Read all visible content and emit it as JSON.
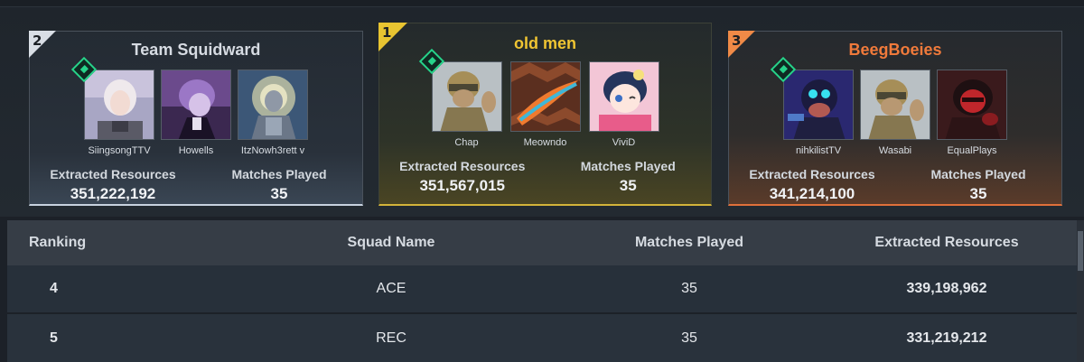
{
  "podium": [
    {
      "rank": "2",
      "team": "Team Squidward",
      "members": [
        {
          "name": "SiingsongTTV",
          "leader": true
        },
        {
          "name": "Howells",
          "leader": false
        },
        {
          "name": "ItzNowh3rett v",
          "leader": false
        }
      ],
      "extracted_label": "Extracted Resources",
      "extracted": "351,222,192",
      "matches_label": "Matches Played",
      "matches": "35"
    },
    {
      "rank": "1",
      "team": "old men",
      "members": [
        {
          "name": "Chap",
          "leader": true
        },
        {
          "name": "Meowndo",
          "leader": false
        },
        {
          "name": "ViviD",
          "leader": false
        }
      ],
      "extracted_label": "Extracted Resources",
      "extracted": "351,567,015",
      "matches_label": "Matches Played",
      "matches": "35"
    },
    {
      "rank": "3",
      "team": "BeegBoeies",
      "members": [
        {
          "name": "nihkilistTV",
          "leader": true
        },
        {
          "name": "Wasabi",
          "leader": false
        },
        {
          "name": "EqualPlays",
          "leader": false
        }
      ],
      "extracted_label": "Extracted Resources",
      "extracted": "341,214,100",
      "matches_label": "Matches Played",
      "matches": "35"
    }
  ],
  "table": {
    "headers": [
      "Ranking",
      "Squad Name",
      "Matches Played",
      "Extracted Resources"
    ],
    "rows": [
      {
        "rank": "4",
        "squad": "ACE",
        "matches": "35",
        "extracted": "339,198,962"
      },
      {
        "rank": "5",
        "squad": "REC",
        "matches": "35",
        "extracted": "331,219,212"
      }
    ]
  },
  "colors": {
    "silver": "#d9dee5",
    "gold": "#e8c431",
    "bronze": "#f08a47",
    "leader": "#27d38a"
  }
}
